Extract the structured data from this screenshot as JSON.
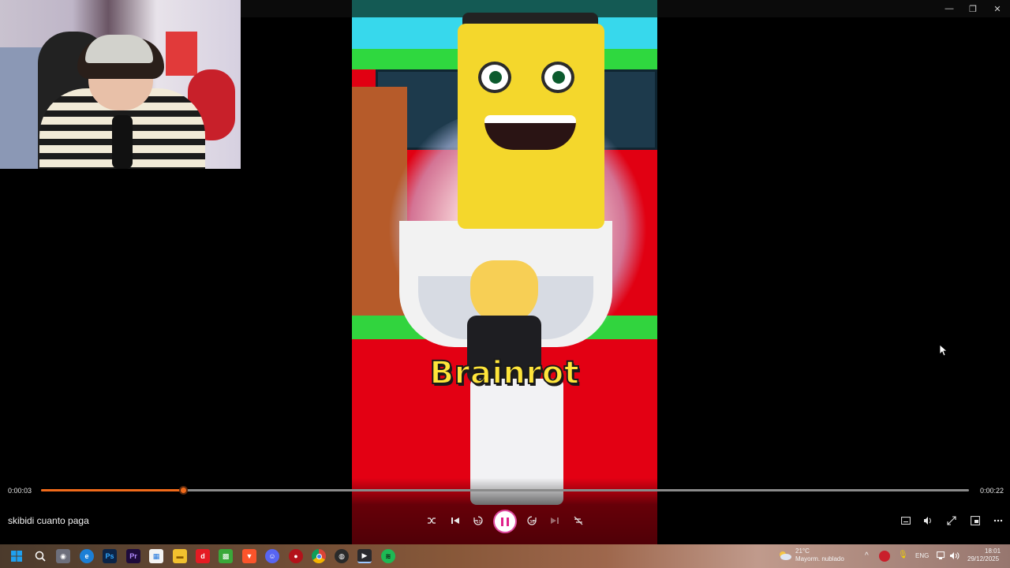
{
  "window": {
    "minimize_glyph": "—",
    "maximize_glyph": "❐",
    "close_glyph": "✕"
  },
  "video": {
    "caption": "Brainrot"
  },
  "player": {
    "title": "skibidi cuanto paga",
    "current_time": "0:00:03",
    "total_time": "0:00:22",
    "progress_fraction": 0.153,
    "accent_color": "#f06a1a",
    "controls": [
      "shuffle-icon",
      "previous-icon",
      "rewind-10-icon",
      "pause-icon",
      "forward-30-icon",
      "next-icon",
      "repeat-off-icon"
    ],
    "right_controls": [
      "subtitles-icon",
      "volume-icon",
      "fullscreen-icon",
      "mini-player-icon",
      "more-icon"
    ]
  },
  "taskbar": {
    "weather_temp": "21°C",
    "weather_desc": "Mayorm. nublado",
    "language": "ENG",
    "time": "18:01",
    "date": "29/12/2025",
    "pinned": [
      "windows-start-icon",
      "search-icon",
      "gamepad-icon",
      "edge-icon",
      "photoshop-icon",
      "premiere-icon",
      "store-icon",
      "file-explorer-icon",
      "app-red-icon",
      "minecraft-icon",
      "brave-icon",
      "discord-icon",
      "app-circle-icon",
      "chrome-icon",
      "obs-icon",
      "media-player-icon",
      "spotify-icon"
    ]
  }
}
